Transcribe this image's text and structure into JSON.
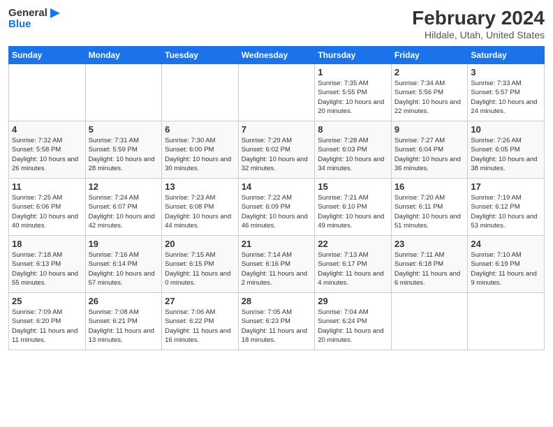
{
  "header": {
    "logo_general": "General",
    "logo_blue": "Blue",
    "month_title": "February 2024",
    "location": "Hildale, Utah, United States"
  },
  "weekdays": [
    "Sunday",
    "Monday",
    "Tuesday",
    "Wednesday",
    "Thursday",
    "Friday",
    "Saturday"
  ],
  "weeks": [
    [
      {
        "day": "",
        "sunrise": "",
        "sunset": "",
        "daylight": ""
      },
      {
        "day": "",
        "sunrise": "",
        "sunset": "",
        "daylight": ""
      },
      {
        "day": "",
        "sunrise": "",
        "sunset": "",
        "daylight": ""
      },
      {
        "day": "",
        "sunrise": "",
        "sunset": "",
        "daylight": ""
      },
      {
        "day": "1",
        "sunrise": "Sunrise: 7:35 AM",
        "sunset": "Sunset: 5:55 PM",
        "daylight": "Daylight: 10 hours and 20 minutes."
      },
      {
        "day": "2",
        "sunrise": "Sunrise: 7:34 AM",
        "sunset": "Sunset: 5:56 PM",
        "daylight": "Daylight: 10 hours and 22 minutes."
      },
      {
        "day": "3",
        "sunrise": "Sunrise: 7:33 AM",
        "sunset": "Sunset: 5:57 PM",
        "daylight": "Daylight: 10 hours and 24 minutes."
      }
    ],
    [
      {
        "day": "4",
        "sunrise": "Sunrise: 7:32 AM",
        "sunset": "Sunset: 5:58 PM",
        "daylight": "Daylight: 10 hours and 26 minutes."
      },
      {
        "day": "5",
        "sunrise": "Sunrise: 7:31 AM",
        "sunset": "Sunset: 5:59 PM",
        "daylight": "Daylight: 10 hours and 28 minutes."
      },
      {
        "day": "6",
        "sunrise": "Sunrise: 7:30 AM",
        "sunset": "Sunset: 6:00 PM",
        "daylight": "Daylight: 10 hours and 30 minutes."
      },
      {
        "day": "7",
        "sunrise": "Sunrise: 7:29 AM",
        "sunset": "Sunset: 6:02 PM",
        "daylight": "Daylight: 10 hours and 32 minutes."
      },
      {
        "day": "8",
        "sunrise": "Sunrise: 7:28 AM",
        "sunset": "Sunset: 6:03 PM",
        "daylight": "Daylight: 10 hours and 34 minutes."
      },
      {
        "day": "9",
        "sunrise": "Sunrise: 7:27 AM",
        "sunset": "Sunset: 6:04 PM",
        "daylight": "Daylight: 10 hours and 36 minutes."
      },
      {
        "day": "10",
        "sunrise": "Sunrise: 7:26 AM",
        "sunset": "Sunset: 6:05 PM",
        "daylight": "Daylight: 10 hours and 38 minutes."
      }
    ],
    [
      {
        "day": "11",
        "sunrise": "Sunrise: 7:25 AM",
        "sunset": "Sunset: 6:06 PM",
        "daylight": "Daylight: 10 hours and 40 minutes."
      },
      {
        "day": "12",
        "sunrise": "Sunrise: 7:24 AM",
        "sunset": "Sunset: 6:07 PM",
        "daylight": "Daylight: 10 hours and 42 minutes."
      },
      {
        "day": "13",
        "sunrise": "Sunrise: 7:23 AM",
        "sunset": "Sunset: 6:08 PM",
        "daylight": "Daylight: 10 hours and 44 minutes."
      },
      {
        "day": "14",
        "sunrise": "Sunrise: 7:22 AM",
        "sunset": "Sunset: 6:09 PM",
        "daylight": "Daylight: 10 hours and 46 minutes."
      },
      {
        "day": "15",
        "sunrise": "Sunrise: 7:21 AM",
        "sunset": "Sunset: 6:10 PM",
        "daylight": "Daylight: 10 hours and 49 minutes."
      },
      {
        "day": "16",
        "sunrise": "Sunrise: 7:20 AM",
        "sunset": "Sunset: 6:11 PM",
        "daylight": "Daylight: 10 hours and 51 minutes."
      },
      {
        "day": "17",
        "sunrise": "Sunrise: 7:19 AM",
        "sunset": "Sunset: 6:12 PM",
        "daylight": "Daylight: 10 hours and 53 minutes."
      }
    ],
    [
      {
        "day": "18",
        "sunrise": "Sunrise: 7:18 AM",
        "sunset": "Sunset: 6:13 PM",
        "daylight": "Daylight: 10 hours and 55 minutes."
      },
      {
        "day": "19",
        "sunrise": "Sunrise: 7:16 AM",
        "sunset": "Sunset: 6:14 PM",
        "daylight": "Daylight: 10 hours and 57 minutes."
      },
      {
        "day": "20",
        "sunrise": "Sunrise: 7:15 AM",
        "sunset": "Sunset: 6:15 PM",
        "daylight": "Daylight: 11 hours and 0 minutes."
      },
      {
        "day": "21",
        "sunrise": "Sunrise: 7:14 AM",
        "sunset": "Sunset: 6:16 PM",
        "daylight": "Daylight: 11 hours and 2 minutes."
      },
      {
        "day": "22",
        "sunrise": "Sunrise: 7:13 AM",
        "sunset": "Sunset: 6:17 PM",
        "daylight": "Daylight: 11 hours and 4 minutes."
      },
      {
        "day": "23",
        "sunrise": "Sunrise: 7:11 AM",
        "sunset": "Sunset: 6:18 PM",
        "daylight": "Daylight: 11 hours and 6 minutes."
      },
      {
        "day": "24",
        "sunrise": "Sunrise: 7:10 AM",
        "sunset": "Sunset: 6:19 PM",
        "daylight": "Daylight: 11 hours and 9 minutes."
      }
    ],
    [
      {
        "day": "25",
        "sunrise": "Sunrise: 7:09 AM",
        "sunset": "Sunset: 6:20 PM",
        "daylight": "Daylight: 11 hours and 11 minutes."
      },
      {
        "day": "26",
        "sunrise": "Sunrise: 7:08 AM",
        "sunset": "Sunset: 6:21 PM",
        "daylight": "Daylight: 11 hours and 13 minutes."
      },
      {
        "day": "27",
        "sunrise": "Sunrise: 7:06 AM",
        "sunset": "Sunset: 6:22 PM",
        "daylight": "Daylight: 11 hours and 16 minutes."
      },
      {
        "day": "28",
        "sunrise": "Sunrise: 7:05 AM",
        "sunset": "Sunset: 6:23 PM",
        "daylight": "Daylight: 11 hours and 18 minutes."
      },
      {
        "day": "29",
        "sunrise": "Sunrise: 7:04 AM",
        "sunset": "Sunset: 6:24 PM",
        "daylight": "Daylight: 11 hours and 20 minutes."
      },
      {
        "day": "",
        "sunrise": "",
        "sunset": "",
        "daylight": ""
      },
      {
        "day": "",
        "sunrise": "",
        "sunset": "",
        "daylight": ""
      }
    ]
  ]
}
